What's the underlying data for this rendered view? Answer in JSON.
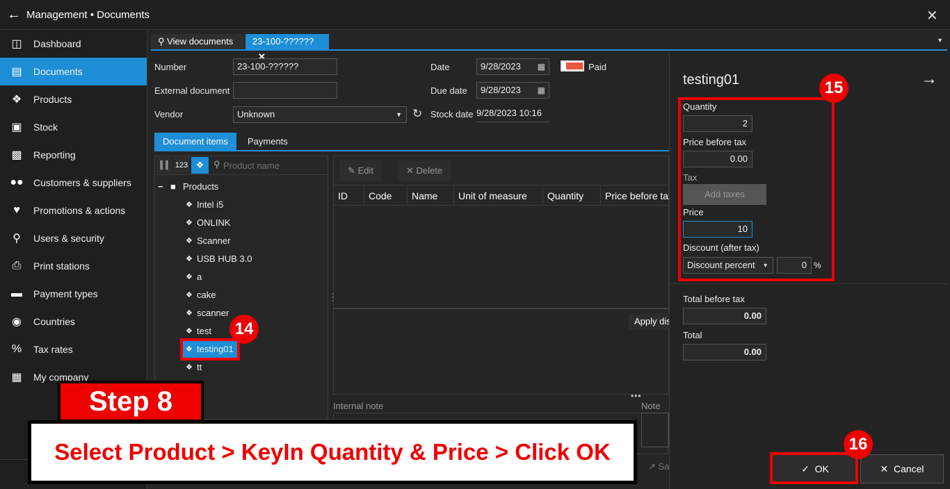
{
  "window": {
    "title": "Management • Documents"
  },
  "sidebar": {
    "items": [
      {
        "label": "Dashboard",
        "icon": "dashboard-icon"
      },
      {
        "label": "Documents",
        "icon": "documents-icon",
        "active": true
      },
      {
        "label": "Products",
        "icon": "tag-icon"
      },
      {
        "label": "Stock",
        "icon": "stock-icon"
      },
      {
        "label": "Reporting",
        "icon": "chart-icon"
      },
      {
        "label": "Customers & suppliers",
        "icon": "users-icon"
      },
      {
        "label": "Promotions & actions",
        "icon": "heart-icon"
      },
      {
        "label": "Users & security",
        "icon": "key-icon"
      },
      {
        "label": "Print stations",
        "icon": "printer-icon"
      },
      {
        "label": "Payment types",
        "icon": "card-icon"
      },
      {
        "label": "Countries",
        "icon": "globe-icon"
      },
      {
        "label": "Tax rates",
        "icon": "percent-icon"
      },
      {
        "label": "My company",
        "icon": "building-icon"
      }
    ]
  },
  "tabs": [
    {
      "label": "View documents",
      "icon": "search-icon"
    },
    {
      "label": "23-100-??????",
      "active": true,
      "close": "✕"
    }
  ],
  "form": {
    "number_label": "Number",
    "number_value": "23-100-??????",
    "external_label": "External document",
    "external_value": "",
    "vendor_label": "Vendor",
    "vendor_value": "Unknown",
    "date_label": "Date",
    "date_value": "9/28/2023",
    "due_label": "Due date",
    "due_value": "9/28/2023",
    "stock_label": "Stock date",
    "stock_value": "9/28/2023 10:16",
    "paid_label": "Paid"
  },
  "subtabs": [
    "Document items",
    "Payments"
  ],
  "tree": {
    "tools": [
      "123"
    ],
    "search_placeholder": "Product name",
    "root": "Products",
    "root_toggle": "−",
    "items": [
      "Intel i5",
      "ONLINK",
      "Scanner",
      "USB HUB 3.0",
      "a",
      "cake",
      "scanner",
      "test",
      "testing01",
      "tt"
    ],
    "selected": "testing01"
  },
  "grid": {
    "edit_label": "Edit",
    "delete_label": "Delete",
    "columns": [
      "ID",
      "Code",
      "Name",
      "Unit of measure",
      "Quantity",
      "Price before tax"
    ],
    "apply_label": "Apply discount",
    "internal_note_label": "Internal note",
    "note_label": "Note",
    "save_label": "Save"
  },
  "details": {
    "title": "testing01",
    "quantity_label": "Quantity",
    "quantity_value": "2",
    "price_before_tax_label": "Price before tax",
    "price_before_tax_value": "0.00",
    "tax_label": "Tax",
    "add_taxes_label": "Add taxes",
    "price_label": "Price",
    "price_value": "10",
    "discount_label": "Discount (after tax)",
    "discount_type": "Discount percent",
    "discount_value": "0",
    "discount_unit": "%",
    "total_before_tax_label": "Total before tax",
    "total_before_tax_value": "0.00",
    "total_label": "Total",
    "total_value": "0.00",
    "ok_label": "OK",
    "cancel_label": "Cancel"
  },
  "overlay": {
    "step": "Step 8",
    "instruction": "Select Product > KeyIn Quantity & Price > Click OK",
    "badge14": "14",
    "badge15": "15",
    "badge16": "16",
    "accent": "#e00000"
  },
  "colors": {
    "accent": "#1e8ed6",
    "background": "#252525",
    "paid_toggle": "#e9573f"
  }
}
